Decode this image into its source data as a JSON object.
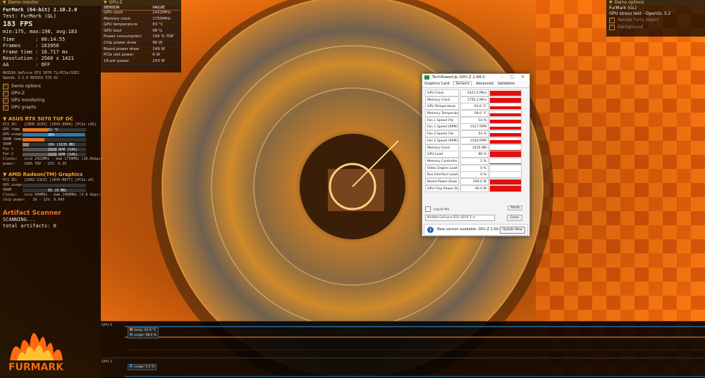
{
  "app": {
    "name_line": "FurMark (64-bit) 2.10.2.0",
    "test_line": "Test: FurMark (GL)",
    "fps": "183 FPS",
    "fps_stats": "min:175, max:198, avg:183",
    "stats": [
      {
        "label": "Time",
        "value": "00:14:55"
      },
      {
        "label": "Frames",
        "value": "163950"
      },
      {
        "label": "Frame time",
        "value": "16.717 ms"
      },
      {
        "label": "Resolution",
        "value": "2560 x 1421"
      },
      {
        "label": "AA",
        "value": "OFF"
      }
    ],
    "renderer_line1": "NVIDIA GeForce RTX 5070 Ti/PCIe/SSE2",
    "renderer_line2": "OpenGL 3.2.0 NVIDIA 576.02",
    "options": [
      {
        "label": "Demo options"
      },
      {
        "label": "GPU-Z"
      },
      {
        "label": "GPU monitoring"
      },
      {
        "label": "GPU graphs"
      }
    ]
  },
  "gpu1": {
    "title": "ASUS RTX 5070 TUF OC",
    "pci_line": "PCI ID:   [10DE-2C05] [1043-8908] [PCIe x16]",
    "bars": [
      {
        "label": "GPU temp",
        "value": "62 °C",
        "pct": 0.4,
        "color": "#e07020"
      },
      {
        "label": "GPU usage",
        "value": "98%",
        "pct": 0.98,
        "color": "#2a7ab8"
      },
      {
        "label": "VRAM temp",
        "value": "",
        "pct": 0.34,
        "color": "#e07020"
      },
      {
        "label": "VRAM",
        "value": "10% (1635 MB)",
        "pct": 0.1,
        "color": "#888888"
      },
      {
        "label": "Fan 1",
        "value": "1529 RPM (54%)",
        "pct": 0.54,
        "color": "#555555"
      },
      {
        "label": "Fan 2",
        "value": "1529 RPM (54%)",
        "pct": 0.54,
        "color": "#555555"
      }
    ],
    "clocks_line": "Clocks:   core 2422MHz - mem 1750MHz (28.0Gbps)",
    "power_line": "power:    100% TDP - 12V: 6.3V"
  },
  "gpu2": {
    "title": "AMD Radeon(TM) Graphics",
    "pci_line": "PCI ID:   [1002-13C0] [1043-8877] [PCIe x0]",
    "bars": [
      {
        "label": "GPU usage",
        "value": "",
        "pct": 0.0,
        "color": "#2a7ab8"
      },
      {
        "label": "VRAM",
        "value": "0% (0 MB)",
        "pct": 0.0,
        "color": "#888888"
      }
    ],
    "clocks_line": "Clocks:   core 600MHz - mem 2400MHz (4.8 Gbps)",
    "power_line": "chip power:   1W - 12V: 0.043"
  },
  "artifact": {
    "title": "Artifact Scanner",
    "status": "SCANNING...",
    "total": "total artifacts: 0"
  },
  "sensor_panel": {
    "header": "GPU-Z",
    "col_sensor": "SENSOR",
    "col_value": "VALUE",
    "rows": [
      {
        "name": "GPU clock",
        "value": "2422MHz"
      },
      {
        "name": "Memory clock",
        "value": "1750MHz"
      },
      {
        "name": "GPU temperature",
        "value": "63 °C"
      },
      {
        "name": "GPU load",
        "value": "98 %"
      },
      {
        "name": "Power consumption",
        "value": "100 % TDP"
      },
      {
        "name": "Chip power draw",
        "value": "96 W"
      },
      {
        "name": "Board power draw",
        "value": "249 W"
      },
      {
        "name": "PCIe slot power",
        "value": "6 W"
      },
      {
        "name": "16-pin power",
        "value": "243 W"
      }
    ]
  },
  "left_header": "Demo monitor",
  "right_panel": {
    "header": "Demo options",
    "line1": "FurMark (GL)",
    "line2": "GPU stress test - OpenGL 3.2",
    "options": [
      {
        "label": "Render furry object"
      },
      {
        "label": "Background"
      }
    ]
  },
  "gpuz": {
    "title": "TechPowerUp GPU-Z 2.68.0",
    "tabs": [
      "Graphics Card",
      "Sensors",
      "Advanced",
      "Validation"
    ],
    "active_tab": "Sensors",
    "rows": [
      {
        "name": "GPU Clock",
        "value": "2422.0 MHz",
        "fill": 0.85
      },
      {
        "name": "Memory Clock",
        "value": "1750.1 MHz",
        "fill": 0.85
      },
      {
        "name": "GPU Temperature",
        "value": "63.0 °C",
        "fill": 0.6
      },
      {
        "name": "Memory Temperature",
        "value": "58.0 °C",
        "fill": 0.55
      },
      {
        "name": "Fan 1 Speed (%)",
        "value": "54 %",
        "fill": 0.6
      },
      {
        "name": "Fan 1 Speed (RPM)",
        "value": "1527 RPM",
        "fill": 0.6
      },
      {
        "name": "Fan 2 Speed (%)",
        "value": "54 %",
        "fill": 0.6
      },
      {
        "name": "Fan 2 Speed (RPM)",
        "value": "1528 RPM",
        "fill": 0.6
      },
      {
        "name": "Memory Used",
        "value": "1635 MB",
        "fill": 0.1
      },
      {
        "name": "GPU Load",
        "value": "98 %",
        "fill": 0.98
      },
      {
        "name": "Memory Controller Load",
        "value": "2 %",
        "fill": 0.05
      },
      {
        "name": "Video Engine Load",
        "value": "0 %",
        "fill": 0.0
      },
      {
        "name": "Bus Interface Load",
        "value": "0 %",
        "fill": 0.0
      },
      {
        "name": "Board Power Draw",
        "value": "249.0 W",
        "fill": 0.9
      },
      {
        "name": "GPU Chip Power Draw",
        "value": "96.0 W",
        "fill": 0.9
      }
    ],
    "log_label": "Log to file",
    "reset_label": "Reset",
    "card_select": "NVIDIA GeForce RTX 5070 Ti",
    "close_label": "Close",
    "update_msg": "New version available: GPU-Z 2.69.0",
    "update_btn": "Update Now"
  },
  "graphs": [
    {
      "label": "GPU 0",
      "legend": [
        {
          "name": "temp: 62.0 °C",
          "color": "#e07020"
        },
        {
          "name": "usage: 98.0 %",
          "color": "#2a7ab8"
        }
      ]
    },
    {
      "label": "GPU 1",
      "legend": [
        {
          "name": "usage: 0.0 %",
          "color": "#2a7ab8"
        }
      ]
    }
  ],
  "colors": {
    "accent": "#f0a030",
    "fur": "#d08a2a",
    "bg_hot": "#ff7a10"
  }
}
